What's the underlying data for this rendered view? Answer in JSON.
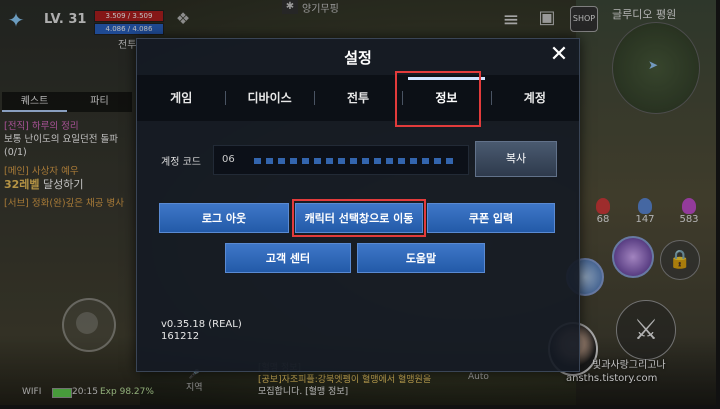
{
  "hud": {
    "level": "LV. 31",
    "hp": "3.509 / 3.509",
    "mp": "4.086 / 4.086",
    "nickname_partial": "전투",
    "top_map_partial": "양기무핑",
    "region": "글루디오 평원",
    "shop_label": "SHOP"
  },
  "quest_panel": {
    "tabs": [
      "퀘스트",
      "파티"
    ],
    "quests": [
      {
        "title": "[전직] 하루의 정리",
        "desc": "보통 난이도의 요일던전 돌파",
        "progress": "(0/1)"
      },
      {
        "title": "[메인] 사상자 예우",
        "desc_level": "32레벨",
        "desc_rest": " 달성하기"
      },
      {
        "title": "[서브] 정화(완)깊은 채공 병사"
      }
    ]
  },
  "status": {
    "wifi": "WIFI",
    "time": "20:15",
    "exp": "Exp 98.27%"
  },
  "chat": {
    "line1": "[혈맹 정보]",
    "line2": "[공보]자조피플:강북엣펭이 혈맹에서 혈맹원을",
    "line3": "모집합니다. [혈맹 정보]",
    "auto_label": "Auto",
    "voice_label": "지역"
  },
  "potions": [
    {
      "count": "68",
      "color": "#d33b3b"
    },
    {
      "count": "147",
      "color": "#5d8ad8"
    },
    {
      "count": "583",
      "color": "#c44fcf"
    }
  ],
  "watermark": {
    "name": "빛과사랑그리고나",
    "url": "ansths.tistory.com"
  },
  "dialog": {
    "title": "설정",
    "close": "✕",
    "tabs": [
      "게임",
      "디바이스",
      "전투",
      "정보",
      "계정"
    ],
    "account_label": "계정 코드",
    "account_code_prefix": "06",
    "copy_label": "복사",
    "buttons": {
      "logout": "로그 아웃",
      "char_select": "캐릭터 선택창으로 이동",
      "coupon": "쿠폰 입력",
      "support": "고객 센터",
      "help": "도움말"
    },
    "version": "v0.35.18 (REAL)",
    "build": "161212"
  }
}
